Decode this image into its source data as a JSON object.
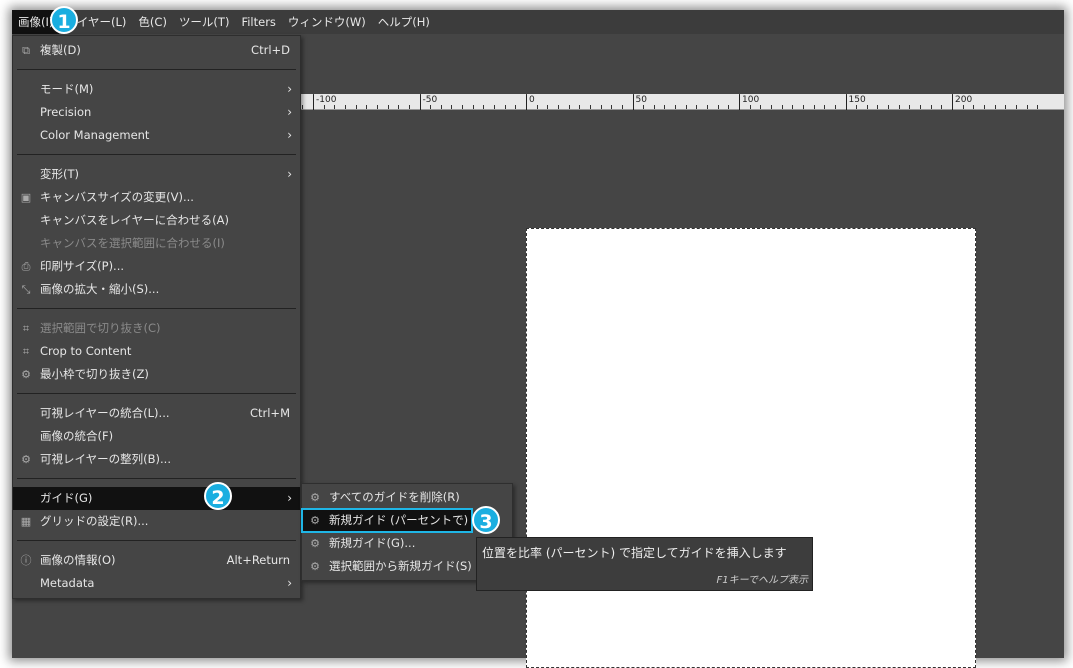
{
  "menubar": [
    "画像(I)",
    "レイヤー(L)",
    "色(C)",
    "ツール(T)",
    "Filters",
    "ウィンドウ(W)",
    "ヘルプ(H)"
  ],
  "ruler": [
    "-100",
    "-50",
    "0",
    "50",
    "100",
    "150",
    "200"
  ],
  "menu": [
    {
      "label": "複製(D)",
      "shortcut": "Ctrl+D",
      "icon": "duplicate-icon"
    },
    {
      "sep": true
    },
    {
      "label": "モード(M)",
      "submenu": true
    },
    {
      "label": "Precision",
      "submenu": true
    },
    {
      "label": "Color Management",
      "submenu": true
    },
    {
      "sep": true
    },
    {
      "label": "変形(T)",
      "submenu": true
    },
    {
      "label": "キャンバスサイズの変更(V)...",
      "icon": "canvas-size-icon"
    },
    {
      "label": "キャンバスをレイヤーに合わせる(A)"
    },
    {
      "label": "キャンバスを選択範囲に合わせる(I)",
      "disabled": true
    },
    {
      "label": "印刷サイズ(P)...",
      "icon": "printer-icon"
    },
    {
      "label": "画像の拡大・縮小(S)...",
      "icon": "scale-icon"
    },
    {
      "sep": true
    },
    {
      "label": "選択範囲で切り抜き(C)",
      "disabled": true,
      "icon": "crop-icon"
    },
    {
      "label": "Crop to Content",
      "icon": "crop-icon"
    },
    {
      "label": "最小枠で切り抜き(Z)",
      "icon": "gear-icon"
    },
    {
      "sep": true
    },
    {
      "label": "可視レイヤーの統合(L)...",
      "shortcut": "Ctrl+M"
    },
    {
      "label": "画像の統合(F)"
    },
    {
      "label": "可視レイヤーの整列(B)...",
      "icon": "gear-icon"
    },
    {
      "sep": true
    },
    {
      "label": "ガイド(G)",
      "submenu": true,
      "highlighted": true
    },
    {
      "label": "グリッドの設定(R)...",
      "icon": "grid-icon"
    },
    {
      "sep": true
    },
    {
      "label": "画像の情報(O)",
      "shortcut": "Alt+Return",
      "icon": "info-icon"
    },
    {
      "label": "Metadata",
      "submenu": true
    }
  ],
  "submenu": [
    {
      "label": "すべてのガイドを削除(R)",
      "icon": "gear-icon"
    },
    {
      "label": "新規ガイド (パーセントで) (P)...",
      "icon": "gear-icon",
      "highlighted": true
    },
    {
      "label": "新規ガイド(G)...",
      "icon": "gear-icon"
    },
    {
      "label": "選択範囲から新規ガイド(S)",
      "icon": "gear-icon"
    }
  ],
  "tooltip": {
    "text": "位置を比率 (パーセント) で指定してガイドを挿入します",
    "hint": "F1キーでヘルプ表示"
  },
  "badges": [
    "1",
    "2",
    "3"
  ],
  "colors": {
    "accent": "#1aaee0",
    "menu_bg": "#454545",
    "highlight": "#111111"
  }
}
